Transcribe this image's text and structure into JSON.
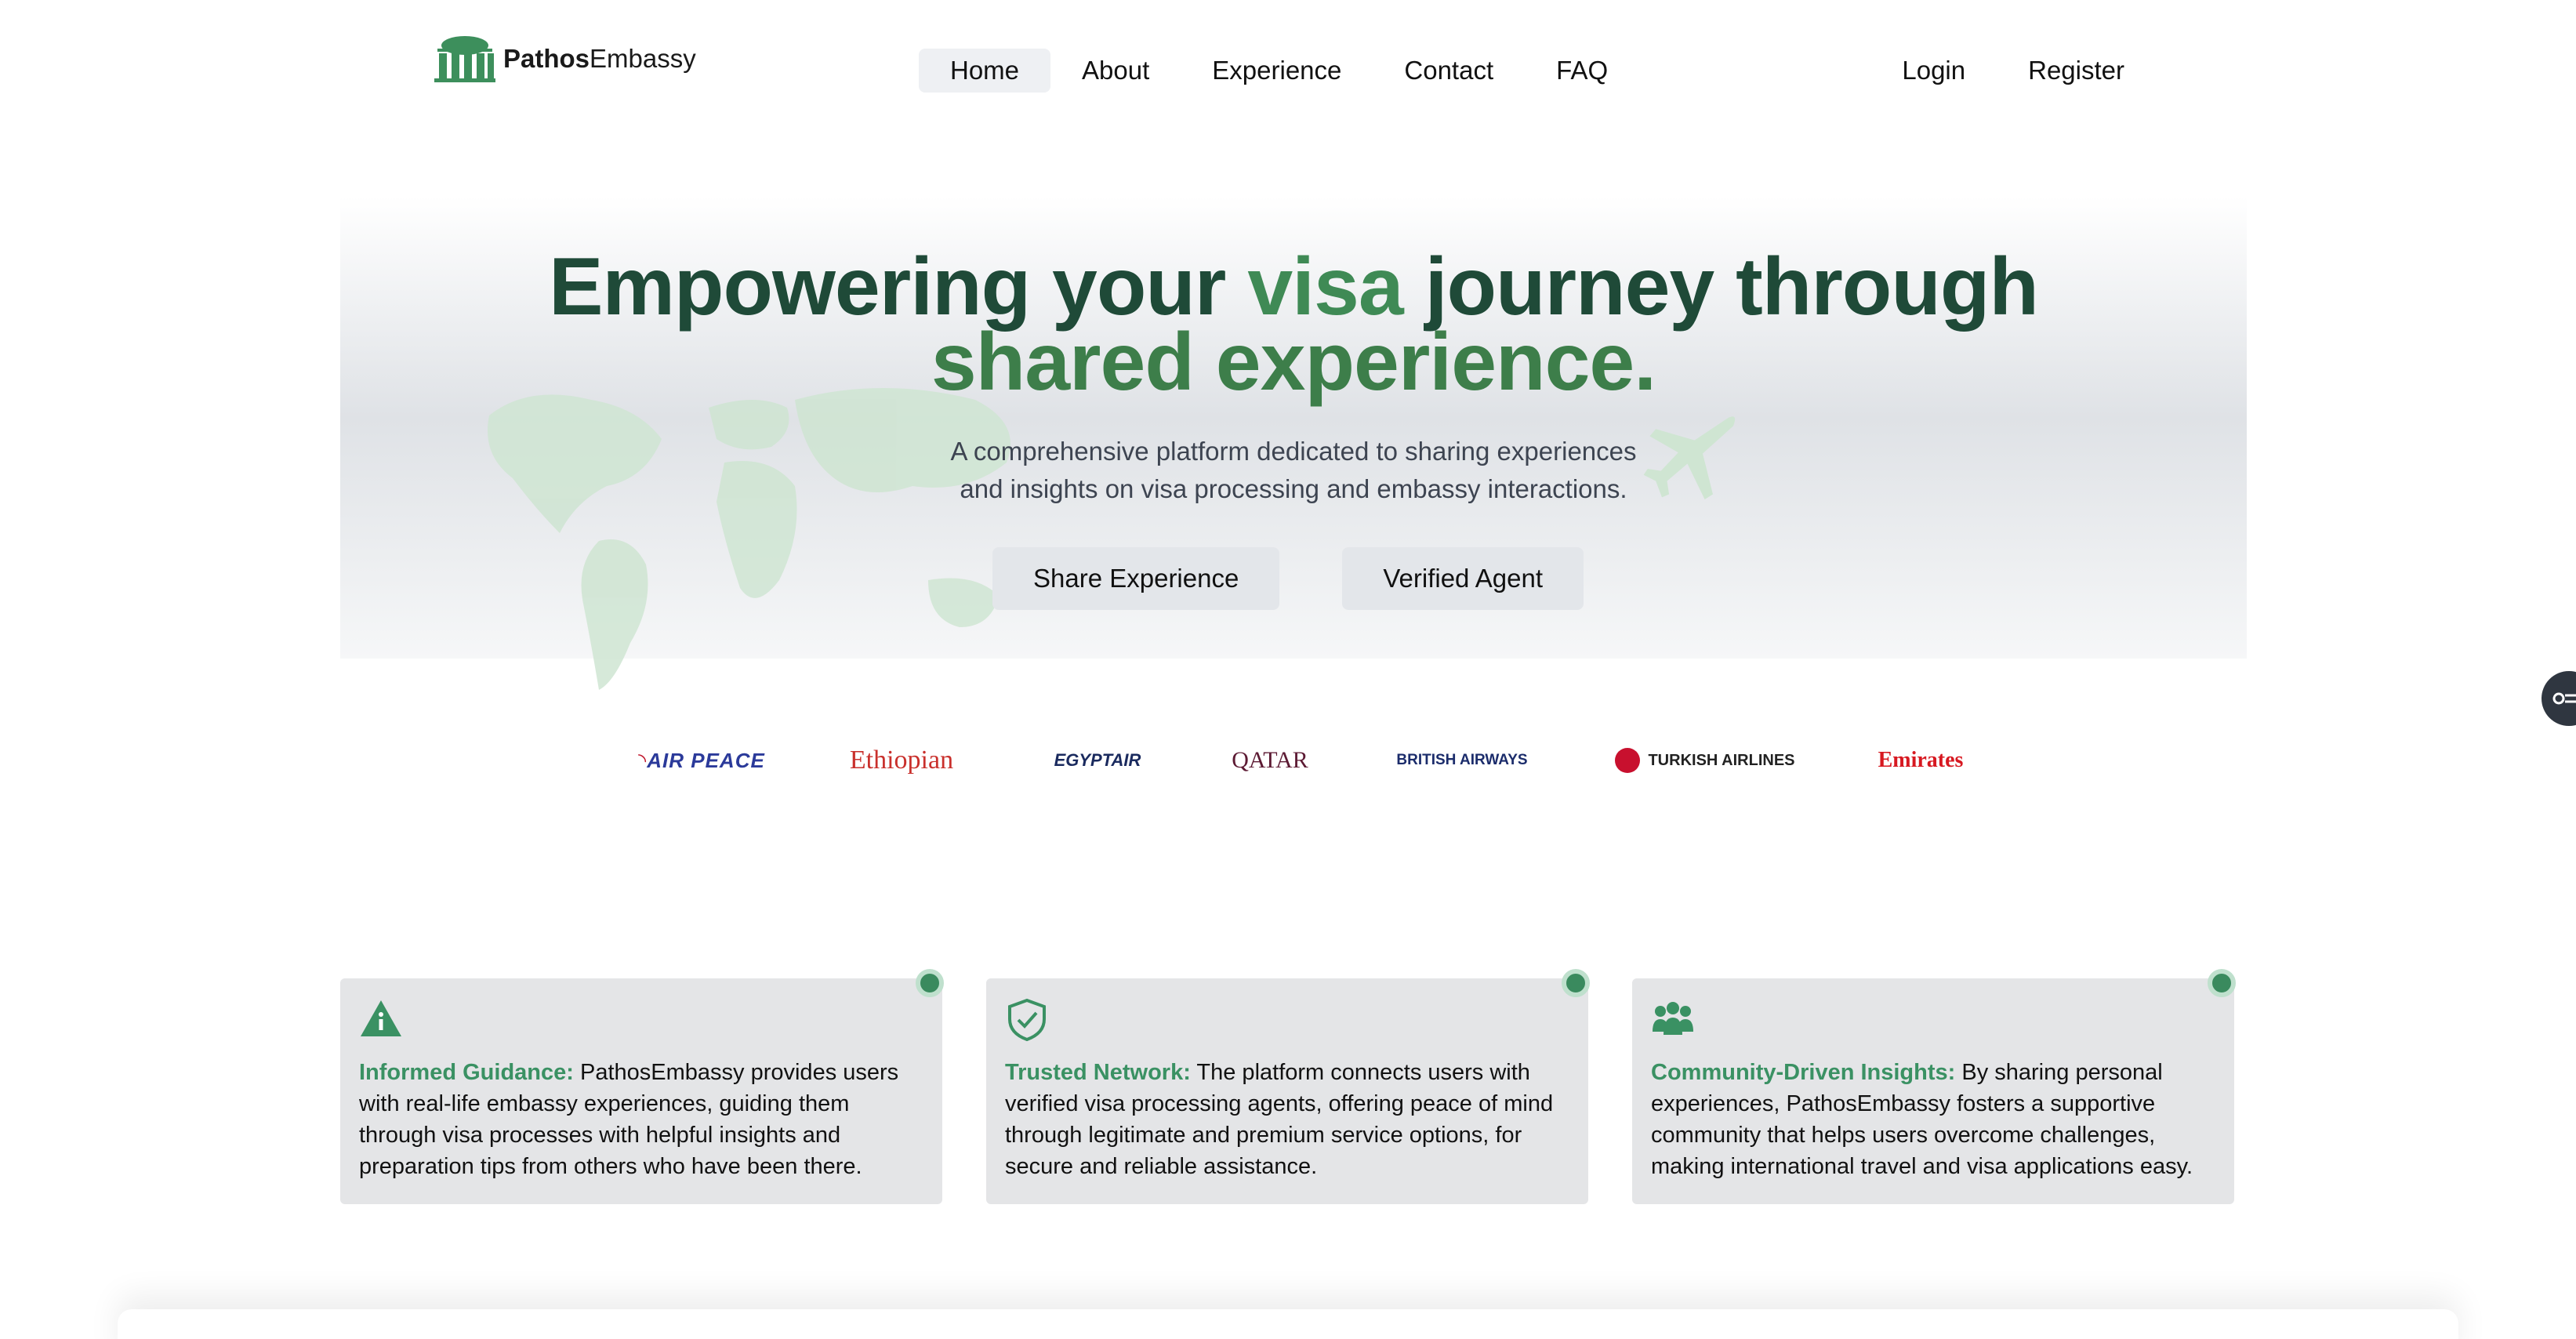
{
  "brand": {
    "name_bold": "Pathos",
    "name_regular": "Embassy"
  },
  "nav": {
    "links": [
      "Home",
      "About",
      "Experience",
      "Contact",
      "FAQ"
    ],
    "active": "Home",
    "login": "Login",
    "register": "Register"
  },
  "hero": {
    "title_part1": "Empowering your ",
    "title_accent": "visa",
    "title_part2": " journey through",
    "title_line2": "shared experience.",
    "subtitle_line1": "A comprehensive platform dedicated to sharing experiences",
    "subtitle_line2": "and insights on visa processing and embassy interactions.",
    "btn_share": "Share Experience",
    "btn_agent": "Verified Agent"
  },
  "airlines": {
    "air_peace": "AIR PEACE",
    "ethiopian": "Ethiopian",
    "egyptair": "EGYPTAIR",
    "qatar": "QATAR",
    "british": "BRITISH AIRWAYS",
    "turkish": "TURKISH AIRLINES",
    "emirates": "Emirates"
  },
  "cards": [
    {
      "icon": "info-warning-icon",
      "highlight": "Informed Guidance:",
      "text": " PathosEmbassy provides users with real-life embassy experiences, guiding them through visa processes with helpful insights and preparation tips from others who have been there."
    },
    {
      "icon": "shield-check-icon",
      "highlight": "Trusted Network:",
      "text": " The platform connects users with verified visa processing agents, offering peace of mind through legitimate and premium service options, for secure and reliable assistance."
    },
    {
      "icon": "community-icon",
      "highlight": "Community-Driven Insights:",
      "text": " By sharing personal experiences, PathosEmbassy fosters a supportive community that helps users overcome challenges, making international travel and visa applications easy."
    }
  ],
  "colors": {
    "primary_green": "#3a9163",
    "dark_green": "#1f4a38",
    "accent_green": "#3f8a55"
  }
}
